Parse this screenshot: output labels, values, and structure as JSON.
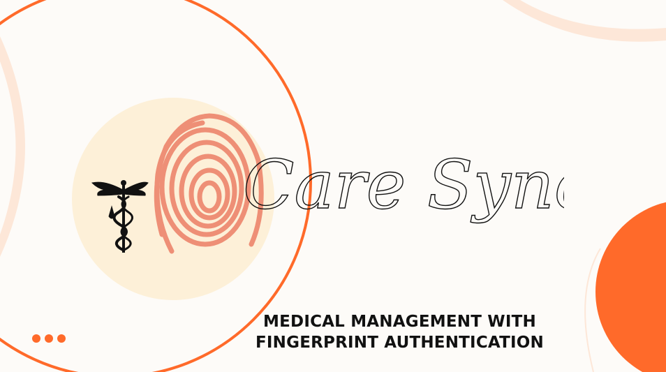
{
  "brand": {
    "title": "Care Sync",
    "subtitle_line1": "MEDICAL MANAGEMENT WITH",
    "subtitle_line2": "FINGERPRINT AUTHENTICATION"
  },
  "icons": {
    "caduceus": "caduceus-icon",
    "fingerprint": "fingerprint-icon",
    "more": "more-dots-icon"
  },
  "colors": {
    "accent_orange": "#ff6a2a",
    "soft_peach": "#fde7d8",
    "cream_circle": "#fdf0d8",
    "fingerprint": "#ee8f76",
    "text": "#111111"
  }
}
